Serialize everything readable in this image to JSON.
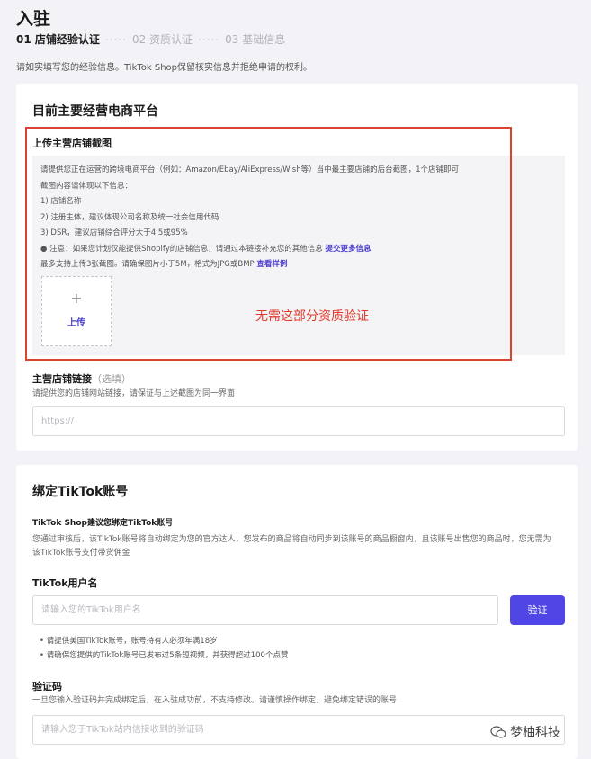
{
  "page": {
    "title": "入驻",
    "steps": [
      "01 店铺经验认证",
      "02 资质认证",
      "03 基础信息"
    ],
    "intro": "请如实填写您的经验信息。TikTok Shop保留核实信息并拒绝申请的权利。"
  },
  "platform_section": {
    "title": "目前主要经营电商平台",
    "upload_label": "上传主营店铺截图",
    "upload_instructions": [
      "请提供您正在运营的跨境电商平台（例如：Amazon/Ebay/AliExpress/Wish等）当中最主要店铺的后台截图，1个店铺即可",
      "截图内容请体现以下信息：",
      "1) 店铺名称",
      "2) 注册主体，建议体现公司名称及统一社会信用代码",
      "3) DSR，建议店铺综合评分大于4.5或95%"
    ],
    "notice_text": "注意：如果您计划仅能提供Shopify的店铺信息，请通过本链接补充您的其他信息",
    "notice_link": "提交更多信息",
    "limits_text": "最多支持上传3张截图。请确保图片小于5M，格式为JPG或BMP",
    "example_link": "查看样例",
    "upload_button_plus": "+",
    "upload_button_label": "上传",
    "annotation": "无需这部分资质验证",
    "store_link_label": "主营店铺链接",
    "store_link_optional": "（选填）",
    "store_link_hint": "请提供您的店铺网站链接，请保证与上述截图为同一界面",
    "store_link_placeholder": "https://"
  },
  "tiktok_section": {
    "title": "绑定TikTok账号",
    "recommend_label": "TikTok Shop建议您绑定TikTok账号",
    "recommend_hint_1": "您通过审核后，该TikTok账号将自动绑定为您的官方达人，您发布的商品将自动同步到该账号的商品橱窗内，且该账号出售您的商品时，您无需为",
    "recommend_hint_2": "该TikTok账号支付带货佣金",
    "username_label": "TikTok用户名",
    "username_placeholder": "请输入您的TikTok用户名",
    "verify_button": "验证",
    "rules": [
      "请提供美国TikTok账号，账号持有人必须年满18岁",
      "请确保您提供的TikTok账号已发布过5条短视频，并获得超过100个点赞"
    ],
    "code_label": "验证码",
    "code_hint": "一旦您输入验证码并完成绑定后，在入驻成功前，不支持修改。请谨慎操作绑定，避免绑定错误的账号",
    "code_placeholder": "请输入您于TikTok站内信接收到的验证码"
  },
  "watermark": {
    "text": "梦柚科技",
    "icon": "wechat-icon"
  }
}
